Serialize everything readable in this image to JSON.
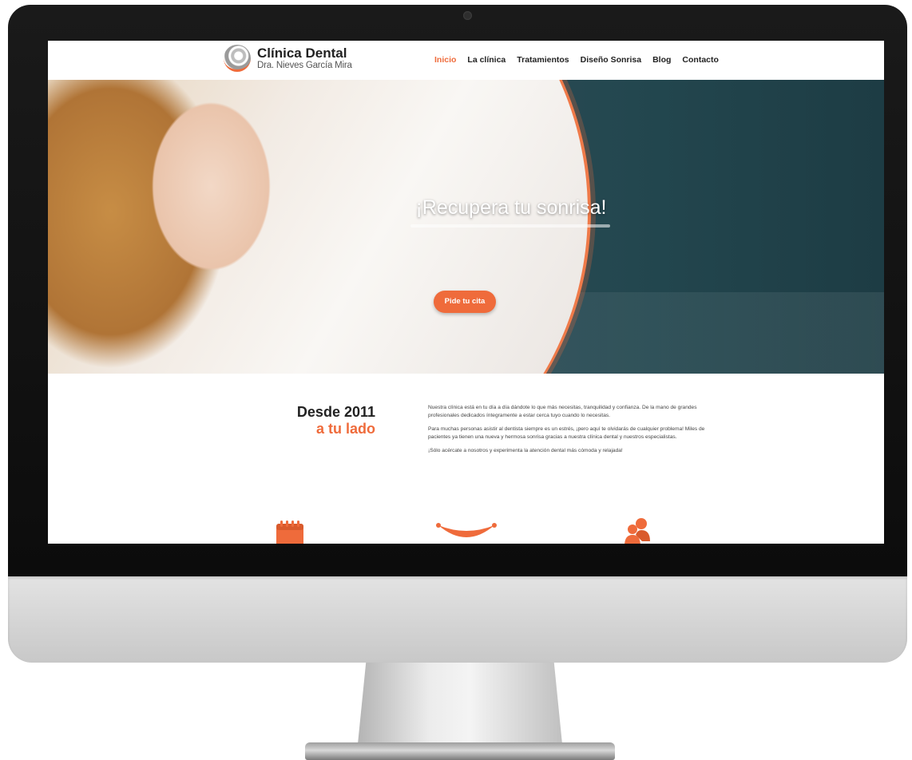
{
  "site": {
    "logo_title": "Clínica Dental",
    "logo_subtitle": "Dra. Nieves García Mira",
    "accent_color": "#ef6b3b"
  },
  "nav": {
    "items": [
      {
        "label": "Inicio",
        "active": true
      },
      {
        "label": "La clínica",
        "active": false
      },
      {
        "label": "Tratamientos",
        "active": false
      },
      {
        "label": "Diseño Sonrisa",
        "active": false
      },
      {
        "label": "Blog",
        "active": false
      },
      {
        "label": "Contacto",
        "active": false
      }
    ]
  },
  "hero": {
    "title": "¡Recupera tu sonrisa!",
    "cta_label": "Pide tu cita"
  },
  "intro": {
    "heading_line1": "Desde 2011",
    "heading_line2": "a tu lado",
    "paragraphs": [
      "Nuestra clínica está en tu día a día dándote lo que más necesitas, tranquilidad y confianza. De la mano de grandes profesionales dedicados íntegramente a estar cerca tuyo cuando lo necesitas.",
      "Para muchas personas asistir al dentista siempre es un estrés, ¡pero aquí te olvidarás de cualquier problema! Miles de pacientes ya tienen una nueva y hermosa sonrisa gracias a nuestra clínica dental y nuestros especialistas.",
      "¡Sólo acércate a nosotros y experimenta la atención dental más cómoda y relajada!"
    ]
  },
  "features": {
    "icons": [
      "calendar-icon",
      "smile-icon",
      "people-icon"
    ]
  }
}
